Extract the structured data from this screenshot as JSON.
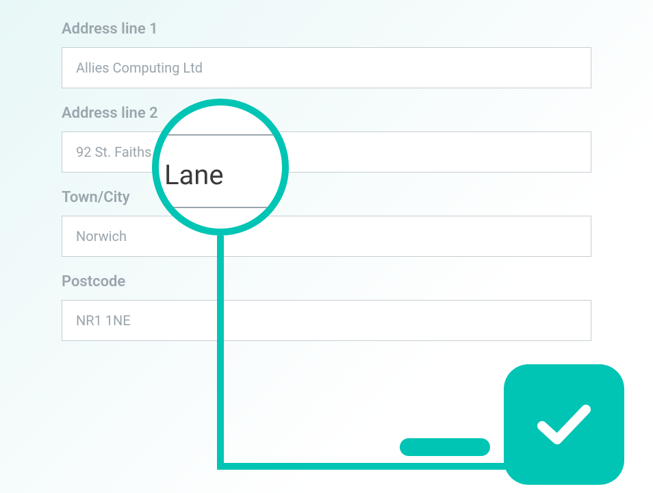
{
  "form": {
    "fields": [
      {
        "label": "Address line 1",
        "value": "Allies Computing Ltd"
      },
      {
        "label": "Address line 2",
        "value": "92 St. Faiths Lane"
      },
      {
        "label": "Town/City",
        "value": "Norwich"
      },
      {
        "label": "Postcode",
        "value": "NR1 1NE"
      }
    ]
  },
  "magnifier": {
    "text": "Lane"
  },
  "colors": {
    "accent": "#00c4b4",
    "label": "#9aa5ad",
    "border": "#c5cdd3"
  }
}
